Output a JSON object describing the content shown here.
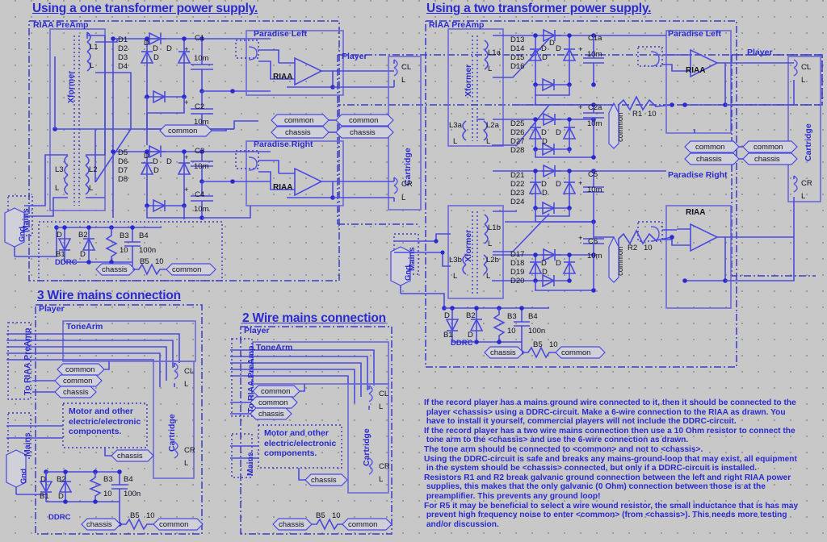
{
  "page": {
    "background_color": "#c8c8c8",
    "ink_color": "#2a2ad0",
    "wire_color": "#4a4ae0",
    "text_black": "#111122"
  },
  "titles": {
    "one_transformer": "Using a one transformer power supply.",
    "two_transformer": "Using a two transformer power supply.",
    "three_wire": "3 Wire mains connection",
    "two_wire": "2 Wire mains connection"
  },
  "common_labels": {
    "riaa_preamp": "RIAA PreAmp",
    "xformer": "Xformer",
    "player": "Player",
    "cartridge": "Cartridge",
    "tonearm": "ToneArm",
    "paradise_left": "Paradise Left",
    "paradise_right": "Paradise Right",
    "riaa": "RIAA",
    "ddrc": "DDRC",
    "common": "common",
    "chassis": "chassis",
    "mains": "Mains",
    "gnd": "Gnd",
    "to_riaa_preamp": "To RIAA PreAmp",
    "motor_note": "Motor and other\nelectric/electronic\ncomponents.",
    "cl": "CL",
    "cr": "CR",
    "l": "L",
    "d": "D"
  },
  "one_transformer": {
    "inductors": [
      "L1",
      "L",
      "L3",
      "L",
      "L2",
      "L"
    ],
    "diode_groups": [
      {
        "labels": [
          "D1",
          "D2",
          "D3",
          "D4"
        ]
      },
      {
        "labels": [
          "D5",
          "D6",
          "D7",
          "D8"
        ]
      }
    ],
    "capacitors": [
      {
        "ref": "C1",
        "value": "10m"
      },
      {
        "ref": "C2",
        "value": "10m"
      },
      {
        "ref": "C3",
        "value": "10m"
      },
      {
        "ref": "C4",
        "value": "10m"
      }
    ],
    "ddrc": {
      "d_top": "D",
      "b1": "B1",
      "b2": "B2",
      "d_bottom": "D",
      "b3": "B3",
      "b3_value": "10",
      "b4": "B4",
      "b4_value": "100n",
      "b5": "B5",
      "b5_value": "10",
      "name": "DDRC"
    }
  },
  "two_transformer": {
    "inductors": [
      "L1a",
      "L",
      "L3a",
      "L",
      "L2a",
      "L",
      "L1b",
      "L",
      "L3b",
      "L",
      "L2b",
      "L"
    ],
    "diode_groups": [
      {
        "labels": [
          "D13",
          "D14",
          "D15",
          "D16"
        ]
      },
      {
        "labels": [
          "D25",
          "D26",
          "D27",
          "D28"
        ]
      },
      {
        "labels": [
          "D21",
          "D22",
          "D23",
          "D24"
        ]
      },
      {
        "labels": [
          "D17",
          "D18",
          "D19",
          "D20"
        ]
      }
    ],
    "capacitors": [
      {
        "ref": "C1a",
        "value": "10m"
      },
      {
        "ref": "C2a",
        "value": "10m"
      },
      {
        "ref": "C5",
        "value": "10m"
      },
      {
        "ref": "C6",
        "value": "10m"
      }
    ],
    "resistors": [
      {
        "ref": "R1",
        "value": "10"
      },
      {
        "ref": "R2",
        "value": "10"
      }
    ],
    "ddrc": {
      "d_top": "D",
      "b1": "B1",
      "b2": "B2",
      "d_bottom": "D",
      "b3": "B3",
      "b3_value": "10",
      "b4": "B4",
      "b4_value": "100n",
      "b5": "B5",
      "b5_value": "10",
      "name": "DDRC"
    }
  },
  "three_wire": {
    "ddrc": {
      "d_top": "D",
      "b1": "B1",
      "b2": "B2",
      "d_bottom": "D",
      "b3": "B3",
      "b3_value": "10",
      "b4": "B4",
      "b4_value": "100n",
      "b5": "B5",
      "b5_value": "10",
      "name": "DDRC"
    }
  },
  "two_wire": {
    "resistor": {
      "ref": "B5",
      "value": "10"
    }
  },
  "notes": {
    "lines": [
      "If the record player has a mains ground wire connected to it, then it should be connected to the",
      " player <chassis> using a DDRC-circuit. Make a 6-wire connection to the RIAA as drawn. You",
      " have to install it yourself, commercial players will not include the DDRC-circuit.",
      "If the record player has a two wire mains connection then use a 10 Ohm resistor to connect the",
      " tone arm to the <chassis> and use the 6-wire connection as drawn.",
      "The tone arm should be connected to <common> and not to <chassis>.",
      "Using the DDRC-circuit is safe and breaks any mains-ground-loop that may exist, all equipment",
      " in the system should be <chassis> connected, but only if a DDRC-circuit is installed.",
      "Resistors R1 and R2 break galvanic ground connection between the left and right RIAA power",
      " supplies, this makes that the only galvanic (0 Ohm) connection between those is at the",
      " preamplifier. This prevents any ground loop!",
      "For R5 it may be beneficial to select a wire wound resistor, the small inductance that is has may",
      " prevent high frequency noise to enter <common> (from <chassis>). This needs more testing",
      " and/or discussion."
    ]
  }
}
